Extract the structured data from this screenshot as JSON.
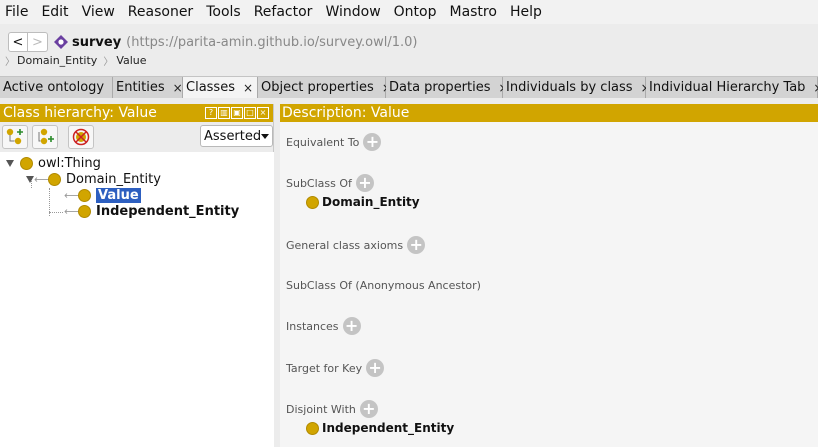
{
  "menu": [
    "File",
    "Edit",
    "View",
    "Reasoner",
    "Tools",
    "Refactor",
    "Window",
    "Ontop",
    "Mastro",
    "Help"
  ],
  "address": {
    "back_label": "<",
    "forward_label": ">",
    "ontology_icon": "ontology-diamond-icon",
    "ontology_name": "survey",
    "ontology_iri": "(https://parita-amin.github.io/survey.owl/1.0)"
  },
  "breadcrumb": [
    "Domain_Entity",
    "Value"
  ],
  "tabs": [
    {
      "label": "Active ontology",
      "close": "×",
      "active": false
    },
    {
      "label": "Entities",
      "close": "×",
      "active": false
    },
    {
      "label": "Classes",
      "close": "×",
      "active": true
    },
    {
      "label": "Object properties",
      "close": "×",
      "active": false
    },
    {
      "label": "Data properties",
      "close": "×",
      "active": false
    },
    {
      "label": "Individuals by class",
      "close": "×",
      "active": false
    },
    {
      "label": "Individual Hierarchy Tab",
      "close": "×",
      "active": false
    }
  ],
  "left_panel": {
    "title": "Class hierarchy: Value",
    "header_controls": [
      "?",
      "▥",
      "▣",
      "□",
      "×"
    ],
    "mode_select": "Asserted",
    "tree": {
      "root": "owl:Thing",
      "child": "Domain_Entity",
      "grandchildren": [
        "Value",
        "Independent_Entity"
      ],
      "selected": "Value"
    }
  },
  "right_panel": {
    "title": "Description: Value",
    "sections": {
      "equivalent_to": "Equivalent To",
      "subclass_of": "SubClass Of",
      "subclass_of_values": [
        "Domain_Entity"
      ],
      "general_class_axioms": "General class axioms",
      "subclass_of_anon": "SubClass Of (Anonymous Ancestor)",
      "instances": "Instances",
      "target_for_key": "Target for Key",
      "disjoint_with": "Disjoint With",
      "disjoint_with_values": [
        "Independent_Entity"
      ]
    },
    "add_symbol": "+"
  },
  "colors": {
    "accent": "#d1a500",
    "selection": "#2d5fc0"
  }
}
